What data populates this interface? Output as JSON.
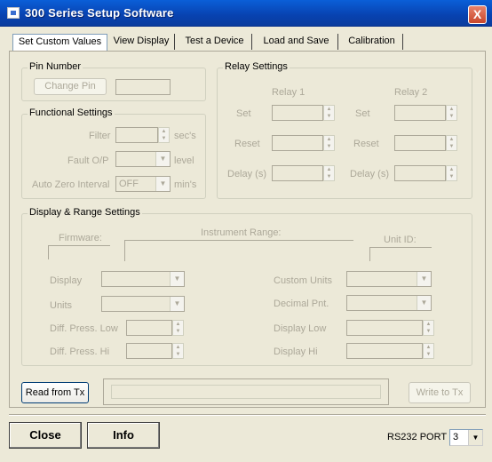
{
  "window": {
    "title": "300 Series Setup Software",
    "close_glyph": "X"
  },
  "tabs": [
    "Set Custom Values",
    "View Display",
    "Test a Device",
    "Load and Save",
    "Calibration"
  ],
  "pin": {
    "legend": "Pin Number",
    "change_button": "Change Pin",
    "value": ""
  },
  "functional": {
    "legend": "Functional Settings",
    "filter_label": "Filter",
    "filter_value": "",
    "filter_unit": "sec's",
    "fault_label": "Fault O/P",
    "fault_value": "",
    "fault_unit": "level",
    "autozero_label": "Auto Zero Interval",
    "autozero_value": "OFF",
    "autozero_unit": "min's"
  },
  "relay": {
    "legend": "Relay Settings",
    "relay1": "Relay 1",
    "relay2": "Relay 2",
    "set": "Set",
    "reset": "Reset",
    "delay": "Delay (s)"
  },
  "display_range": {
    "legend": "Display & Range Settings",
    "firmware": "Firmware:",
    "instrument_range": "Instrument Range:",
    "unit_id": "Unit ID:",
    "display": "Display",
    "units": "Units",
    "diff_low": "Diff. Press. Low",
    "diff_hi": "Diff. Press. Hi",
    "custom_units": "Custom Units",
    "decimal_pnt": "Decimal Pnt.",
    "display_low": "Display Low",
    "display_hi": "Display Hi"
  },
  "io": {
    "read_button": "Read from Tx",
    "write_button": "Write to Tx",
    "status_text": ""
  },
  "footer": {
    "close_button": "Close",
    "info_button": "Info",
    "port_label": "RS232 PORT",
    "port_value": "3"
  },
  "icons": {
    "spin_up": "▲",
    "spin_down": "▼",
    "dropdown": "▼"
  }
}
